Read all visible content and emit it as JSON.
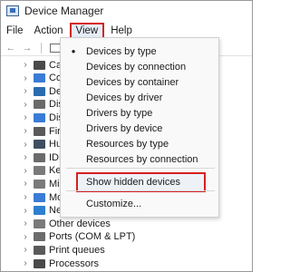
{
  "window": {
    "title": "Device Manager"
  },
  "menubar": {
    "items": [
      {
        "label": "File"
      },
      {
        "label": "Action"
      },
      {
        "label": "View"
      },
      {
        "label": "Help"
      }
    ]
  },
  "toolbar": {
    "buttons": [
      "back-icon",
      "forward-icon",
      "properties-icon"
    ]
  },
  "tree": {
    "items": [
      {
        "label": "Cam",
        "color": "#4a4a4a"
      },
      {
        "label": "Com",
        "color": "#3a7bd5"
      },
      {
        "label": "Dell",
        "color": "#2b6cb0"
      },
      {
        "label": "Disk",
        "color": "#6b6b6b"
      },
      {
        "label": "Disp",
        "color": "#3a7bd5"
      },
      {
        "label": "Firm",
        "color": "#5a5a5a"
      },
      {
        "label": "Hum",
        "color": "#3f4f62"
      },
      {
        "label": "IDE /",
        "color": "#6b6b6b"
      },
      {
        "label": "Keyb",
        "color": "#7a7a7a"
      },
      {
        "label": "Mice",
        "color": "#7a7a7a"
      },
      {
        "label": "Mon",
        "color": "#3a7bd5"
      },
      {
        "label": "Netw",
        "color": "#2f7fcf"
      },
      {
        "label": "Other devices",
        "color": "#7a7a7a"
      },
      {
        "label": "Ports (COM & LPT)",
        "color": "#6b6b6b"
      },
      {
        "label": "Print queues",
        "color": "#5a5a5a"
      },
      {
        "label": "Processors",
        "color": "#4a4a4a"
      }
    ]
  },
  "view_menu": {
    "items": [
      {
        "label": "Devices by type",
        "checked": true,
        "check_glyph": "•"
      },
      {
        "label": "Devices by connection",
        "checked": false,
        "check_glyph": ""
      },
      {
        "label": "Devices by container",
        "checked": false,
        "check_glyph": ""
      },
      {
        "label": "Devices by driver",
        "checked": false,
        "check_glyph": ""
      },
      {
        "label": "Drivers by type",
        "checked": false,
        "check_glyph": ""
      },
      {
        "label": "Drivers by device",
        "checked": false,
        "check_glyph": ""
      },
      {
        "label": "Resources by type",
        "checked": false,
        "check_glyph": ""
      },
      {
        "label": "Resources by connection",
        "checked": false,
        "check_glyph": ""
      },
      {
        "label": "Show hidden devices",
        "checked": false,
        "check_glyph": ""
      },
      {
        "label": "Customize...",
        "checked": false,
        "check_glyph": ""
      }
    ]
  },
  "colors": {
    "highlight_border": "#d62020",
    "menu_background": "#f9f9f9"
  }
}
